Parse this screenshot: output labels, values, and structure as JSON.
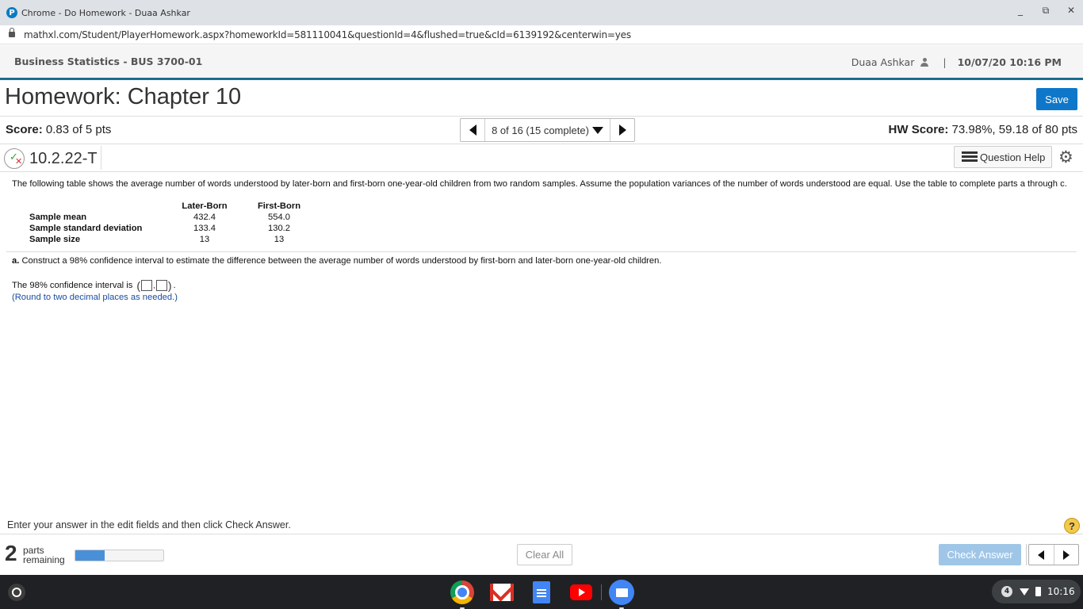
{
  "window": {
    "title": "Chrome - Do Homework - Duaa Ashkar",
    "app_icon_letter": "P",
    "controls": [
      "_",
      "⧉",
      "✕"
    ]
  },
  "browser": {
    "url": "mathxl.com/Student/PlayerHomework.aspx?homeworkId=581110041&questionId=4&flushed=true&cId=6139192&centerwin=yes"
  },
  "header": {
    "course": "Business Statistics - BUS 3700-01",
    "user": "Duaa Ashkar",
    "separator": "|",
    "datetime": "10/07/20 10:16 PM"
  },
  "homework": {
    "title": "Homework: Chapter 10",
    "save_label": "Save",
    "score_label": "Score:",
    "score_value": "0.83 of 5 pts",
    "nav_text": "8 of 16 (15 complete)",
    "hw_score_label": "HW Score:",
    "hw_score_value": "73.98%, 59.18 of 80 pts"
  },
  "question": {
    "id": "10.2.22-T",
    "help_label": "Question Help",
    "prompt": "The following table shows the average number of words understood by later-born and first-born one-year-old children from two random samples. Assume the population variances of the number of words understood are equal. Use the table to complete parts a through c.",
    "table": {
      "headers": [
        "Later-Born",
        "First-Born"
      ],
      "rows": [
        {
          "label": "Sample mean",
          "values": [
            "432.4",
            "554.0"
          ]
        },
        {
          "label": "Sample standard deviation",
          "values": [
            "133.4",
            "130.2"
          ]
        },
        {
          "label": "Sample size",
          "values": [
            "13",
            "13"
          ]
        }
      ]
    },
    "part_a_label": "a.",
    "part_a_text": "Construct a 98% confidence interval to estimate the difference between the average number of words understood by first-born and later-born one-year-old children.",
    "ci_text": "The 98% confidence interval is",
    "ci_open": "(",
    "ci_comma": ",",
    "ci_close": ")",
    "ci_end": ".",
    "ci_lower": "",
    "ci_upper": "",
    "round_hint": "(Round to two decimal places as needed.)"
  },
  "footer": {
    "instruction": "Enter your answer in the edit fields and then click Check Answer.",
    "help_symbol": "?",
    "parts_count": "2",
    "parts_label_1": "parts",
    "parts_label_2": "remaining",
    "progress_fraction": 0.33,
    "clear_all_label": "Clear All",
    "check_answer_label": "Check Answer"
  },
  "taskbar": {
    "apps": [
      "chrome-icon",
      "gmail-icon",
      "docs-icon",
      "youtube-icon",
      "files-icon"
    ],
    "notification_count": "4",
    "time": "10:16"
  },
  "colors": {
    "accent": "#0e77c9",
    "header_border": "#1c6e8c",
    "hint_blue": "#1a4da0",
    "check_disabled": "#9fc6e7",
    "progress_fill": "#4a90d9"
  }
}
